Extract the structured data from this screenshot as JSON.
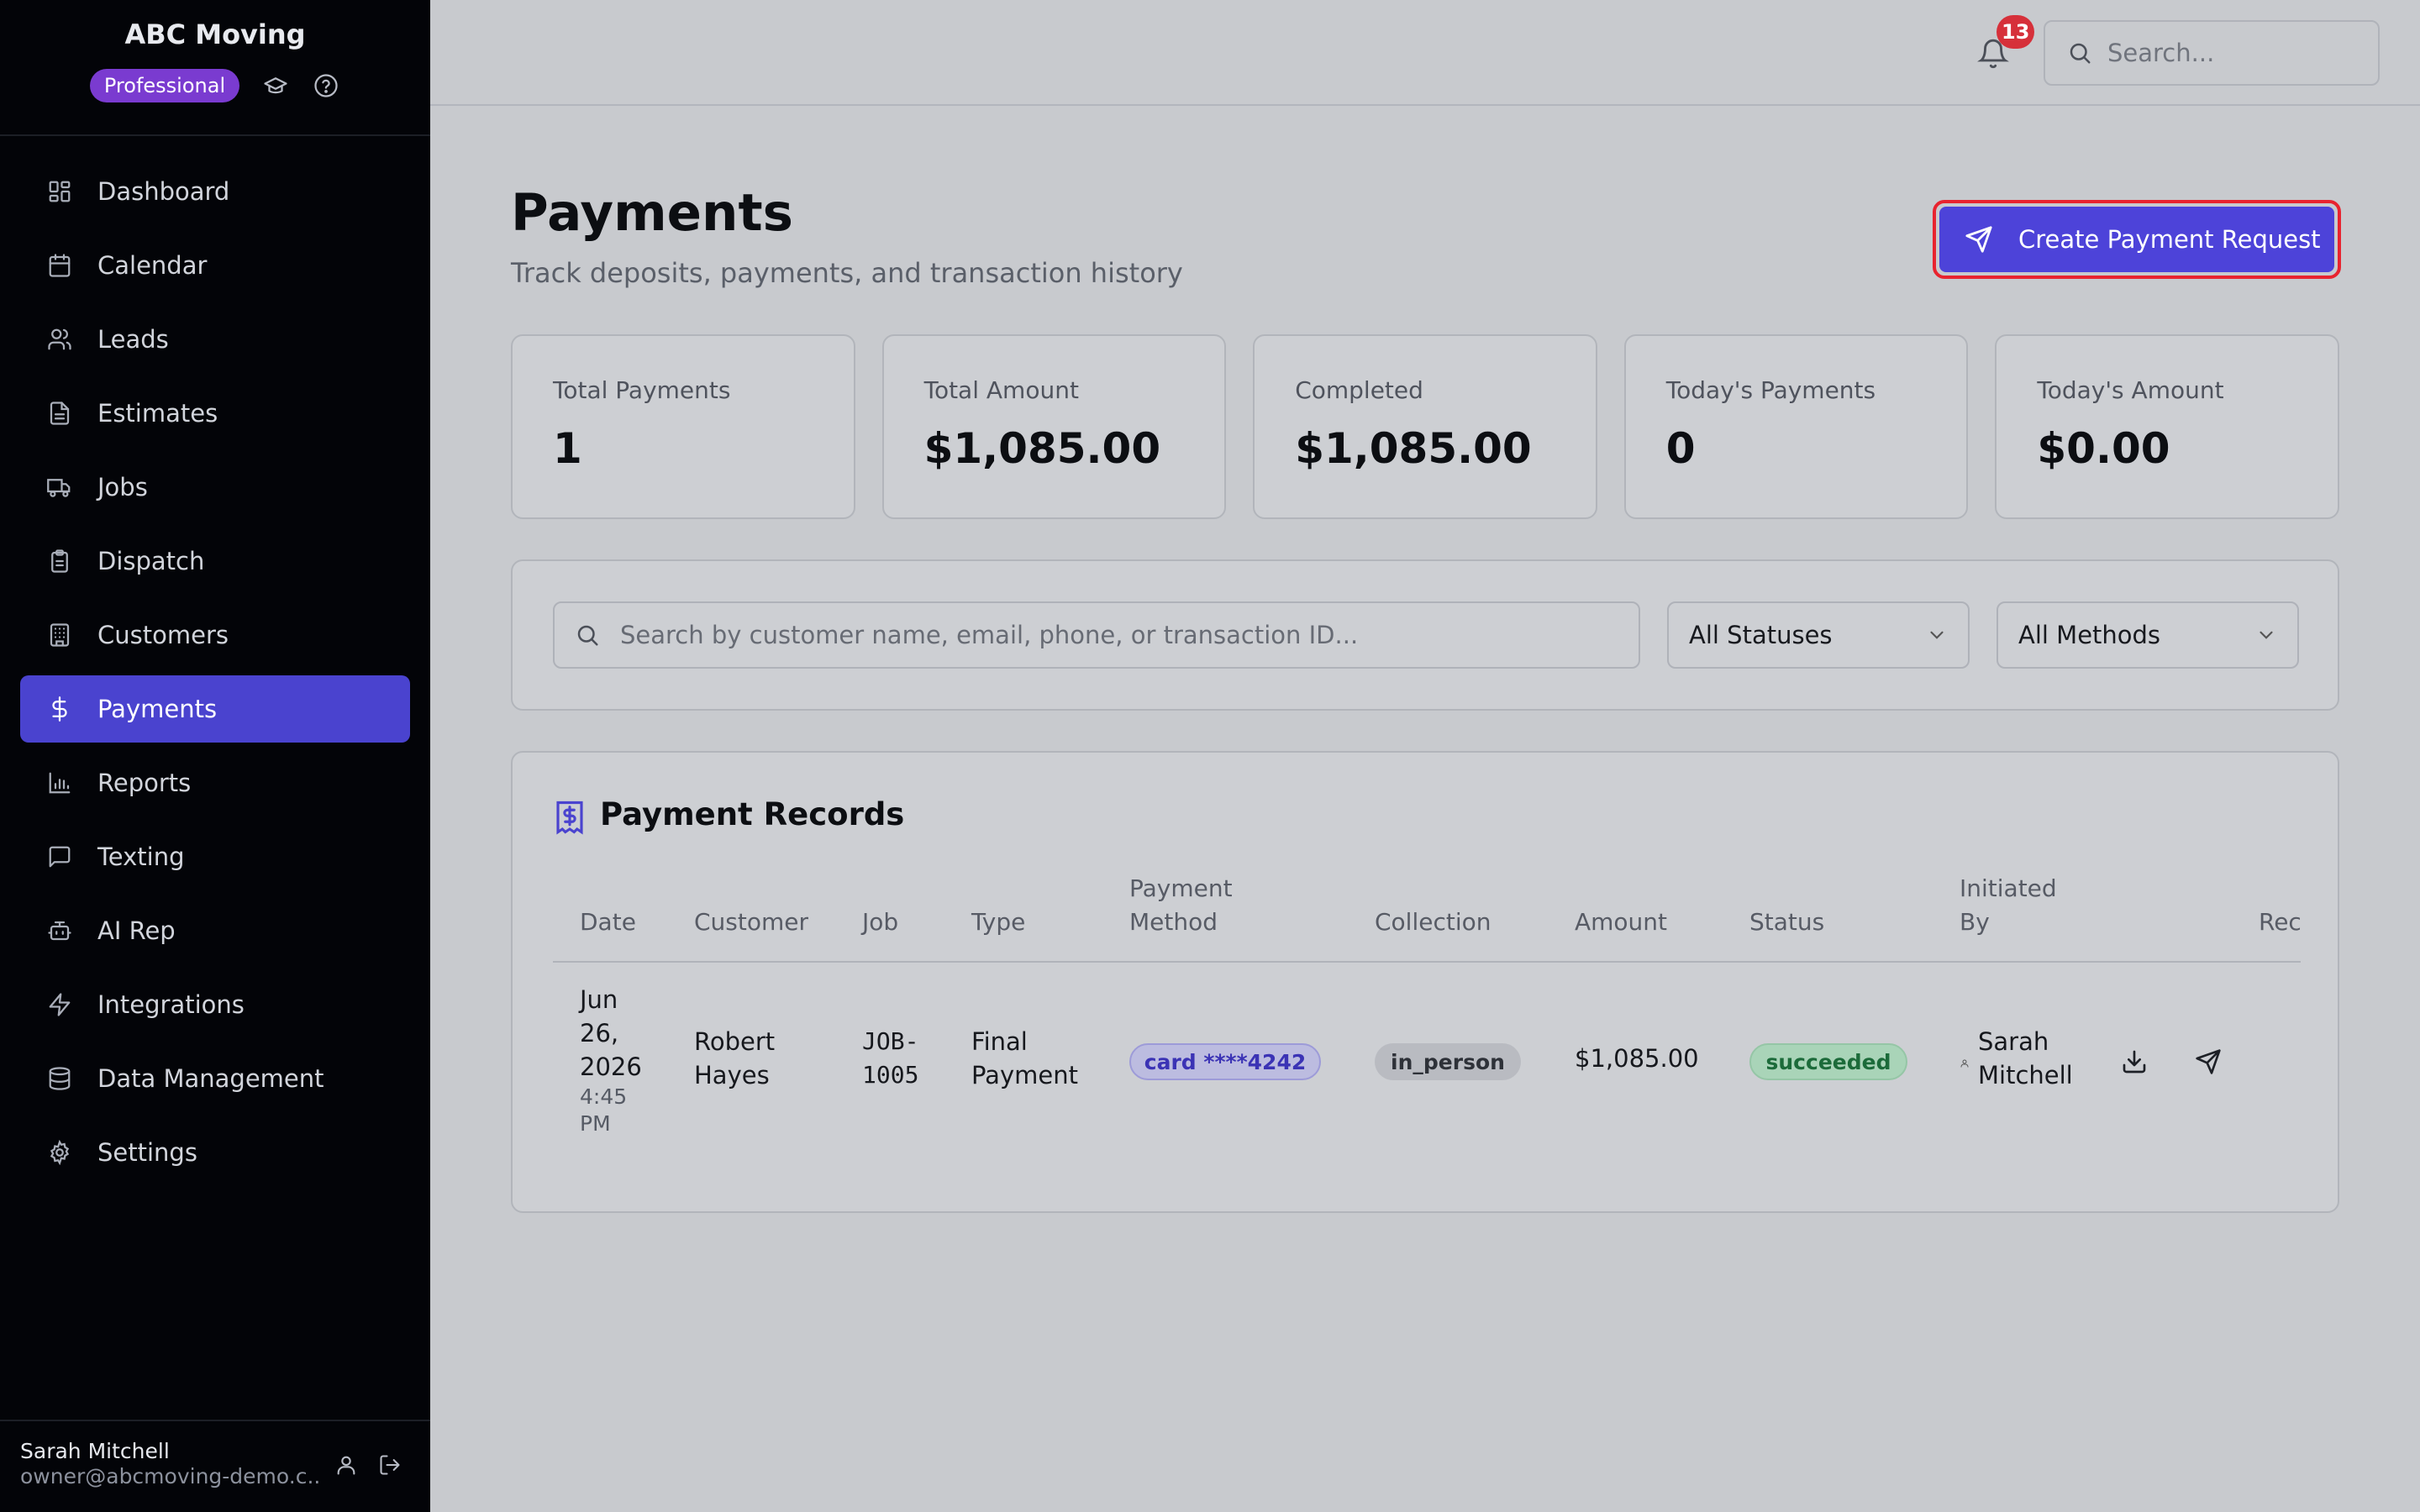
{
  "brand": {
    "name": "ABC Moving",
    "plan": "Professional"
  },
  "sidebar": {
    "items": [
      {
        "label": "Dashboard",
        "icon": "dashboard-icon"
      },
      {
        "label": "Calendar",
        "icon": "calendar-icon"
      },
      {
        "label": "Leads",
        "icon": "users-icon"
      },
      {
        "label": "Estimates",
        "icon": "document-icon"
      },
      {
        "label": "Jobs",
        "icon": "truck-icon"
      },
      {
        "label": "Dispatch",
        "icon": "clipboard-icon"
      },
      {
        "label": "Customers",
        "icon": "building-icon"
      },
      {
        "label": "Payments",
        "icon": "dollar-icon",
        "active": true
      },
      {
        "label": "Reports",
        "icon": "bar-chart-icon"
      },
      {
        "label": "Texting",
        "icon": "message-icon"
      },
      {
        "label": "AI Rep",
        "icon": "bot-icon"
      },
      {
        "label": "Integrations",
        "icon": "lightning-icon"
      },
      {
        "label": "Data Management",
        "icon": "database-icon"
      },
      {
        "label": "Settings",
        "icon": "gear-icon"
      }
    ],
    "user": {
      "name": "Sarah Mitchell",
      "email": "owner@abcmoving-demo.c..."
    }
  },
  "topbar": {
    "notification_count": "13",
    "search_placeholder": "Search..."
  },
  "header": {
    "title": "Payments",
    "subtitle": "Track deposits, payments, and transaction history",
    "create_button": "Create Payment Request"
  },
  "stats": [
    {
      "label": "Total Payments",
      "value": "1"
    },
    {
      "label": "Total Amount",
      "value": "$1,085.00"
    },
    {
      "label": "Completed",
      "value": "$1,085.00"
    },
    {
      "label": "Today's Payments",
      "value": "0"
    },
    {
      "label": "Today's Amount",
      "value": "$0.00"
    }
  ],
  "filters": {
    "search_placeholder": "Search by customer name, email, phone, or transaction ID...",
    "status_value": "All Statuses",
    "method_value": "All Methods"
  },
  "records": {
    "title": "Payment Records",
    "headers": {
      "date": "Date",
      "customer": "Customer",
      "job": "Job",
      "type": "Type",
      "method_1": "Payment",
      "method_2": "Method",
      "collection": "Collection",
      "amount": "Amount",
      "status": "Status",
      "initiated_1": "Initiated",
      "initiated_2": "By",
      "receipt": "Rec"
    },
    "rows": [
      {
        "date_1": "Jun",
        "date_2": "26,",
        "date_3": "2026",
        "time_1": "4:45",
        "time_2": "PM",
        "customer_1": "Robert",
        "customer_2": "Hayes",
        "job_1": "JOB-",
        "job_2": "1005",
        "type_1": "Final",
        "type_2": "Payment",
        "method": "card ****4242",
        "collection": "in_person",
        "amount": "$1,085.00",
        "status": "succeeded",
        "initiated_1": "Sarah",
        "initiated_2": "Mitchell"
      }
    ]
  },
  "colors": {
    "accent": "#4a43cf",
    "badge_red": "#d6303a",
    "plan_purple": "#7a3bd0",
    "success_bg": "#a9d4b8",
    "success_text": "#1c6b3a"
  }
}
